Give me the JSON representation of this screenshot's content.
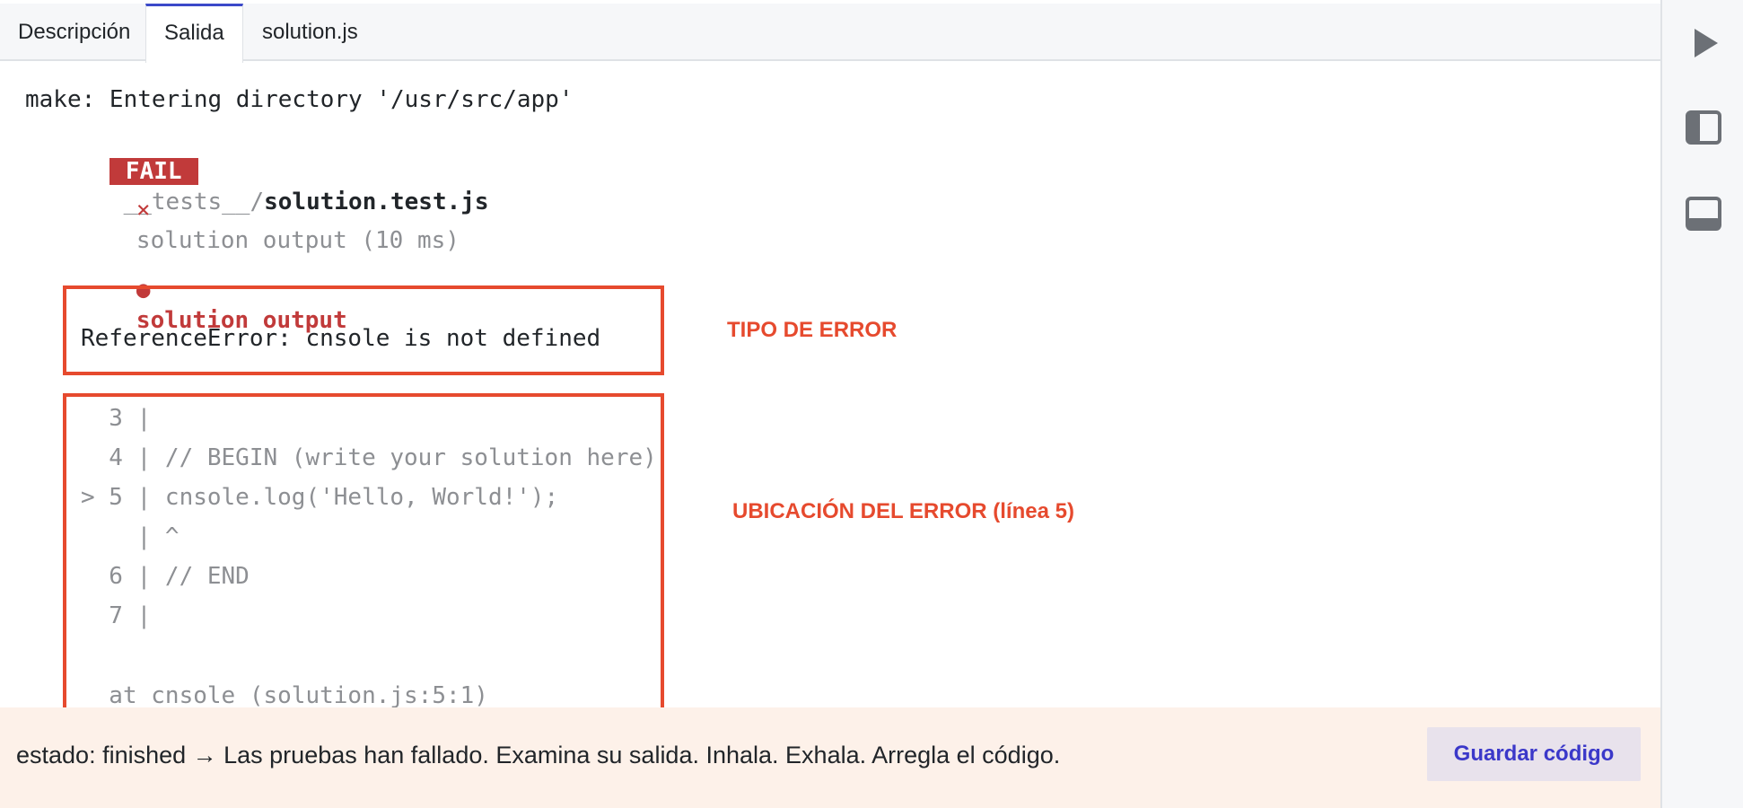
{
  "tabs": [
    {
      "label": "Descripción",
      "active": false
    },
    {
      "label": "Salida",
      "active": true
    },
    {
      "label": "solution.js",
      "active": false
    }
  ],
  "output": {
    "line1": "make: Entering directory '/usr/src/app'",
    "fail_badge": "FAIL",
    "test_path_prefix": "__tests__/",
    "test_path_file": "solution.test.js",
    "fail_mark": "×",
    "test_result": "solution output (10 ms)",
    "bullet": "●",
    "section_title": "solution output",
    "error_message": "ReferenceError: cnsole is not defined",
    "code_lines": [
      "  3 |",
      "  4 | // BEGIN (write your solution here)",
      "> 5 | cnsole.log('Hello, World!');",
      "    | ^",
      "  6 | // END",
      "  7 |"
    ],
    "stack_line": "  at cnsole (solution.js:5:1)"
  },
  "annotations": {
    "error_type": "TIPO DE ERROR",
    "error_location": "UBICACIÓN DEL ERROR (línea 5)"
  },
  "status": {
    "text": "estado: finished → Las pruebas han fallado. Examina su salida. Inhala. Exhala. Arregla el código.",
    "save_label": "Guardar código"
  },
  "sidebar": {
    "icons": [
      "play-icon",
      "panel-left-icon",
      "panel-bottom-icon"
    ]
  },
  "colors": {
    "fail": "#c13a3a",
    "annotation": "#e64a2e",
    "accent": "#3b49c9",
    "status_bg": "#fdf1e9"
  }
}
